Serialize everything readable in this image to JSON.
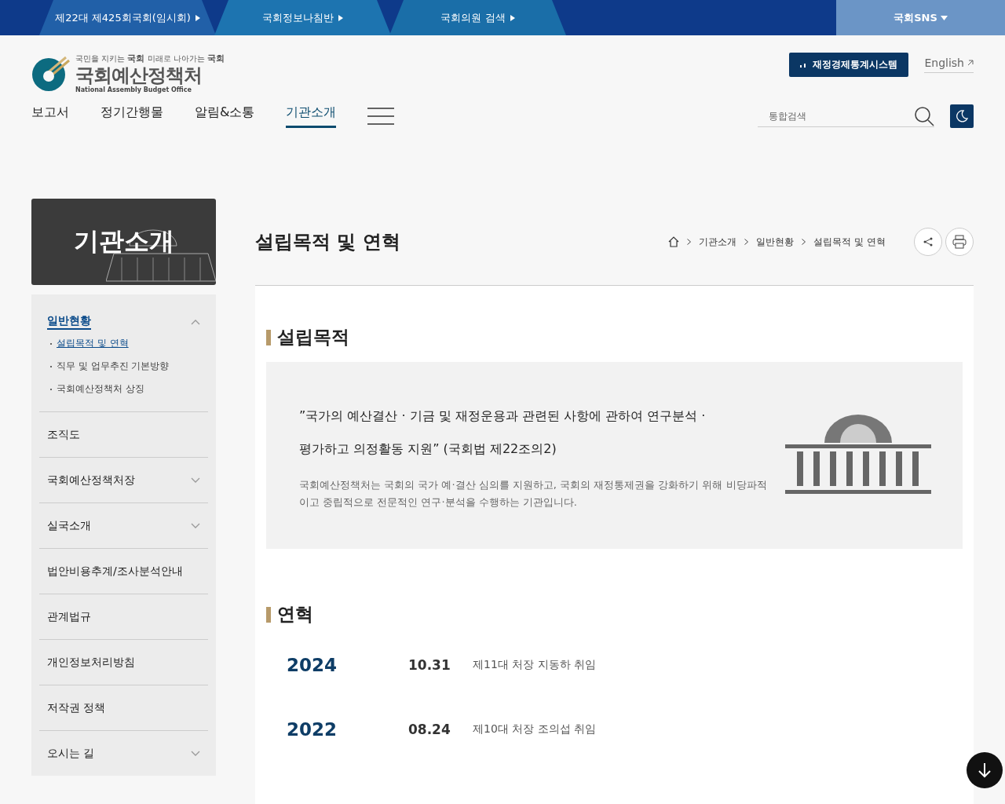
{
  "top_bar": {
    "links": [
      {
        "label": "제22대 제425회국회(임시회)"
      },
      {
        "label": "국회정보나침반"
      },
      {
        "label": "국회의원 검색"
      }
    ],
    "sns_button": "국회SNS"
  },
  "header": {
    "logo": {
      "tagline_parts": [
        "국민을 지키는",
        "국회",
        "미래로 나아가는",
        "국회"
      ],
      "name": "국회예산정책처",
      "english": "National Assembly Budget Office"
    },
    "stats_button": "재정경제통계시스템",
    "language_link": "English",
    "nav": [
      {
        "label": "보고서",
        "selected": false
      },
      {
        "label": "정기간행물",
        "selected": false
      },
      {
        "label": "알림&소통",
        "selected": false
      },
      {
        "label": "기관소개",
        "selected": true
      }
    ],
    "search": {
      "placeholder": "통합검색"
    }
  },
  "sidebar": {
    "banner_title": "기관소개",
    "menu": [
      {
        "label": "일반현황",
        "kind": "group",
        "expanded": true,
        "selected": true,
        "children": [
          {
            "label": "설립목적 및 연혁",
            "selected": true
          },
          {
            "label": "직무 및 업무추진 기본방향",
            "selected": false
          },
          {
            "label": "국회예산정책처 상징",
            "selected": false
          }
        ]
      },
      {
        "label": "조직도",
        "kind": "link",
        "selected": false
      },
      {
        "label": "국회예산정책처장",
        "kind": "group",
        "expanded": false,
        "selected": false
      },
      {
        "label": "실국소개",
        "kind": "group",
        "expanded": false,
        "selected": false
      },
      {
        "label": "법안비용추계/조사분석안내",
        "kind": "link",
        "selected": false
      },
      {
        "label": "관계법규",
        "kind": "link",
        "selected": false
      },
      {
        "label": "개인정보처리방침",
        "kind": "link",
        "selected": false
      },
      {
        "label": "저작권 정책",
        "kind": "link",
        "selected": false
      },
      {
        "label": "오시는 길",
        "kind": "group",
        "expanded": false,
        "selected": false
      }
    ]
  },
  "page": {
    "title": "설립목적 및 연혁",
    "breadcrumb": [
      "기관소개",
      "일반현황",
      "설립목적 및 연혁"
    ],
    "purpose": {
      "heading": "설립목적",
      "quote_lines": [
        "”국가의 예산결산 · 기금 및 재정운용과 관련된 사항에 관하여 연구분석 ·",
        "평가하고 의정활동 지원” (국회법 제22조의2)"
      ],
      "description": "국회예산정책처는 국회의 국가 예·결산 심의를 지원하고, 국회의 재정통제권을 강화하기 위해 비당파적이고 중립적으로 전문적인 연구·분석을 수행하는 기관입니다."
    },
    "history": {
      "heading": "연혁",
      "entries": [
        {
          "year": "2024",
          "date": "10.31",
          "event": "제11대 처장 지동하 취임"
        },
        {
          "year": "2022",
          "date": "08.24",
          "event": "제10대 처장 조의섭 취임"
        }
      ]
    }
  }
}
